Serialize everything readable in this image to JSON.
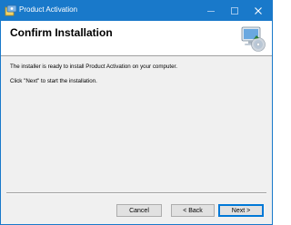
{
  "window": {
    "title": "Product Activation"
  },
  "header": {
    "title": "Confirm Installation"
  },
  "body": {
    "message1": "The installer is ready to install Product Activation on your computer.",
    "message2": "Click \"Next\" to start the installation."
  },
  "buttons": {
    "cancel": "Cancel",
    "back": "< Back",
    "next": "Next >"
  },
  "icons": {
    "app": "installer-icon",
    "header": "computer-cd-icon",
    "minimize": "minimize-icon",
    "maximize": "maximize-icon",
    "close": "close-icon"
  },
  "colors": {
    "titlebar": "#1979ca",
    "accent": "#0078d7",
    "dialog_bg": "#f0f0f0"
  }
}
